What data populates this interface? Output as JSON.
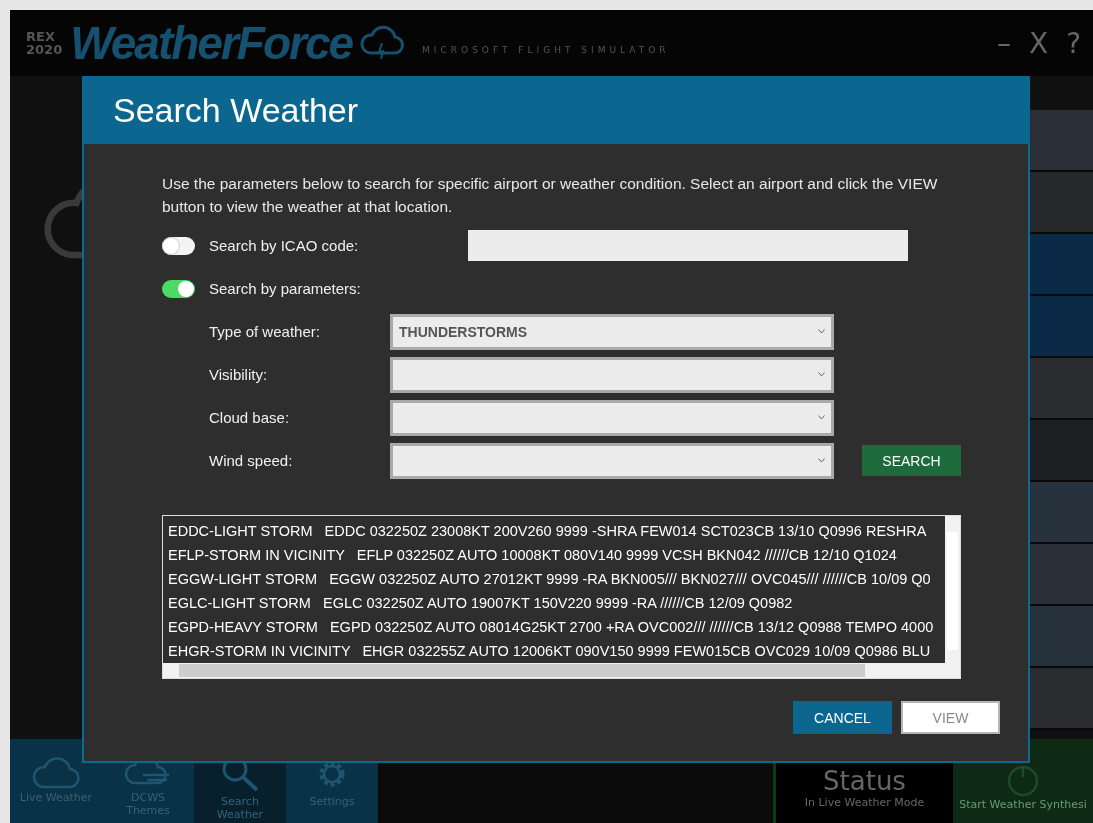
{
  "app": {
    "logo_badge": [
      "REX",
      "2020"
    ],
    "logo_text": "WeatherForce",
    "subtitle": "MICROSOFT FLIGHT SIMULATOR",
    "window_controls": [
      "–",
      "X",
      "?"
    ]
  },
  "nav": [
    {
      "label": "Live Weather",
      "selected": false
    },
    {
      "label": "DCWS Themes",
      "selected": false
    },
    {
      "label": "Search Weather",
      "selected": true
    },
    {
      "label": "Settings",
      "selected": false
    }
  ],
  "status": {
    "title": "Status",
    "subtitle": "In Live Weather Mode"
  },
  "synthesis_button": "Start Weather Synthesi",
  "dialog": {
    "title": "Search Weather",
    "description": "Use the parameters below to search for specific airport or weather condition. Select an airport and click the VIEW button to view the weather at that location.",
    "toggles": [
      {
        "label": "Search by ICAO code:",
        "on": false
      },
      {
        "label": "Search by parameters:",
        "on": true
      }
    ],
    "fields": [
      {
        "label": "Type of weather:",
        "value": "THUNDERSTORMS"
      },
      {
        "label": "Visibility:"
      },
      {
        "label": "Cloud base:"
      },
      {
        "label": "Wind speed:"
      }
    ],
    "search_button": "SEARCH",
    "results": [
      "EDDC-LIGHT STORM   EDDC 032250Z 23008KT 200V260 9999 -SHRA FEW014 SCT023CB 13/10 Q0996 RESHRA",
      "EFLP-STORM IN VICINITY   EFLP 032250Z AUTO 10008KT 080V140 9999 VCSH BKN042 //////CB 12/10 Q1024",
      "EGGW-LIGHT STORM   EGGW 032250Z AUTO 27012KT 9999 -RA BKN005/// BKN027/// OVC045/// //////CB 10/09 Q0",
      "EGLC-LIGHT STORM   EGLC 032250Z AUTO 19007KT 150V220 9999 -RA //////CB 12/09 Q0982",
      "EGPD-HEAVY STORM   EGPD 032250Z AUTO 08014G25KT 2700 +RA OVC002/// //////CB 13/12 Q0988 TEMPO 4000",
      "EHGR-STORM IN VICINITY   EHGR 032255Z AUTO 12006KT 090V150 9999 FEW015CB OVC029 10/09 Q0986 BLU"
    ],
    "buttons": [
      {
        "label": "CANCEL",
        "kind": "primary",
        "disabled": false
      },
      {
        "label": "VIEW",
        "kind": "secondary",
        "disabled": true
      }
    ]
  }
}
